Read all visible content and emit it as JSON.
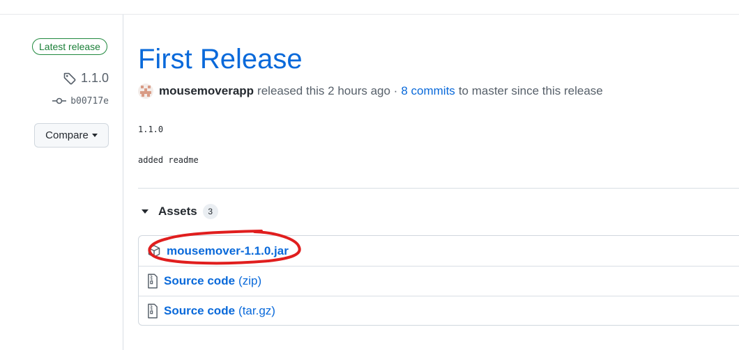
{
  "sidebar": {
    "badge": "Latest release",
    "tag": "1.1.0",
    "commit": "b00717e",
    "compare_label": "Compare"
  },
  "release": {
    "title": "First Release",
    "author": "mousemoverapp",
    "released_text": "released this 2 hours ago ·",
    "commits_link": "8 commits",
    "since_text": "to master since this release",
    "notes": [
      "1.1.0",
      "added readme"
    ]
  },
  "assets": {
    "label": "Assets",
    "count": "3",
    "items": [
      {
        "name": "mousemover-1.1.0.jar",
        "suffix": "",
        "icon": "package-icon"
      },
      {
        "name": "Source code",
        "suffix": "(zip)",
        "icon": "file-zip-icon"
      },
      {
        "name": "Source code",
        "suffix": "(tar.gz)",
        "icon": "file-zip-icon"
      }
    ]
  },
  "colors": {
    "link": "#0969da",
    "badge_green": "#1a7f37",
    "annotation_red": "#e01e1e"
  }
}
